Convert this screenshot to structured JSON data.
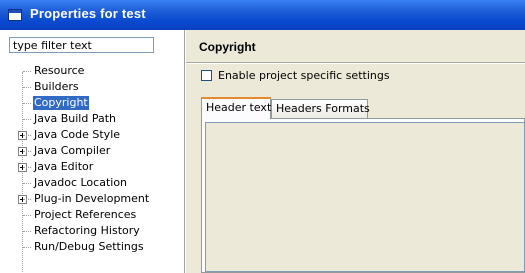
{
  "window": {
    "title": "Properties for test"
  },
  "filter": {
    "value": "type filter text"
  },
  "tree": {
    "items": [
      {
        "label": "Resource",
        "expandable": false,
        "selected": false
      },
      {
        "label": "Builders",
        "expandable": false,
        "selected": false
      },
      {
        "label": "Copyright",
        "expandable": false,
        "selected": true
      },
      {
        "label": "Java Build Path",
        "expandable": false,
        "selected": false
      },
      {
        "label": "Java Code Style",
        "expandable": true,
        "selected": false
      },
      {
        "label": "Java Compiler",
        "expandable": true,
        "selected": false
      },
      {
        "label": "Java Editor",
        "expandable": true,
        "selected": false
      },
      {
        "label": "Javadoc Location",
        "expandable": false,
        "selected": false
      },
      {
        "label": "Plug-in Development",
        "expandable": true,
        "selected": false
      },
      {
        "label": "Project References",
        "expandable": false,
        "selected": false
      },
      {
        "label": "Refactoring History",
        "expandable": false,
        "selected": false
      },
      {
        "label": "Run/Debug Settings",
        "expandable": false,
        "selected": false
      }
    ]
  },
  "page": {
    "title": "Copyright",
    "enable_label": "Enable project specific settings",
    "enable_checked": false,
    "tabs": [
      {
        "label": "Header text",
        "active": true
      },
      {
        "label": "Headers Formats",
        "active": false
      }
    ]
  },
  "colors": {
    "titlebar": "#0a4ad0",
    "selection": "#316ac5",
    "active_tab_accent": "#e68b2c"
  }
}
